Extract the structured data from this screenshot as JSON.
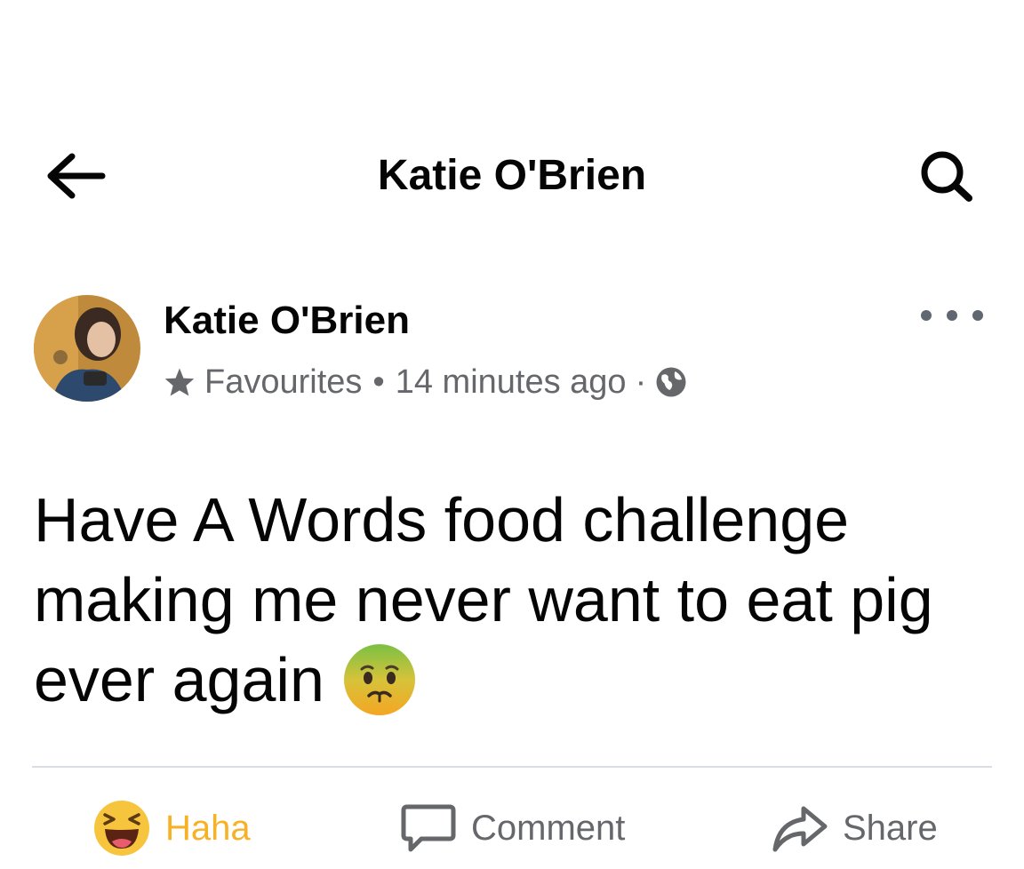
{
  "header": {
    "title": "Katie O'Brien",
    "back_icon": "arrow-left-icon",
    "search_icon": "search-icon"
  },
  "post": {
    "author": "Katie O'Brien",
    "audience": "Favourites",
    "separator": "•",
    "timestamp": "14 minutes ago",
    "separator_small": "·",
    "privacy_icon": "globe-icon",
    "text": "Have A Words food challenge making me never want to eat pig ever again",
    "emoji_icon": "nauseated-face-icon"
  },
  "actions": {
    "reaction_label": "Haha",
    "comment_label": "Comment",
    "share_label": "Share"
  },
  "colors": {
    "text_primary": "#050505",
    "text_secondary": "#65676b",
    "haha_color": "#f7b125",
    "divider": "#dadde1"
  }
}
